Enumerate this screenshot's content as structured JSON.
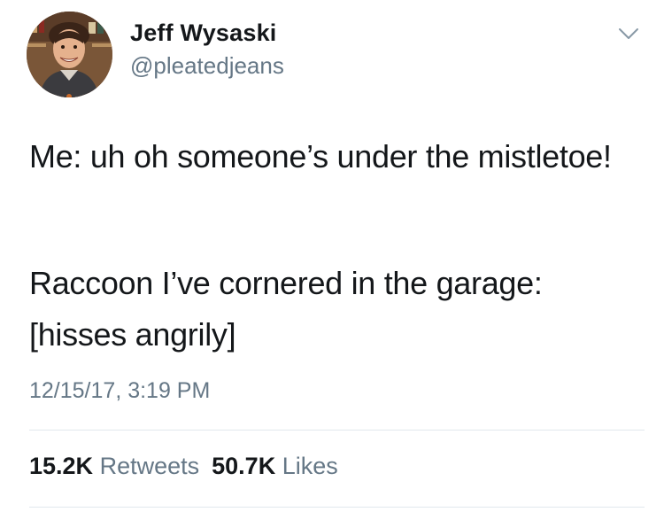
{
  "author": {
    "display_name": "Jeff Wysaski",
    "handle": "@pleatedjeans"
  },
  "tweet": {
    "paragraphs": [
      "Me: uh oh someone’s under the mistletoe!",
      "Raccoon I’ve cornered in the garage: [hisses angrily]"
    ],
    "timestamp": "12/15/17, 3:19 PM"
  },
  "stats": {
    "retweets_count": "15.2K",
    "retweets_label": "Retweets",
    "likes_count": "50.7K",
    "likes_label": "Likes"
  },
  "icons": {
    "menu": "chevron-down-icon"
  },
  "colors": {
    "text": "#14171a",
    "secondary": "#657786",
    "divider": "#e1e8ed"
  }
}
